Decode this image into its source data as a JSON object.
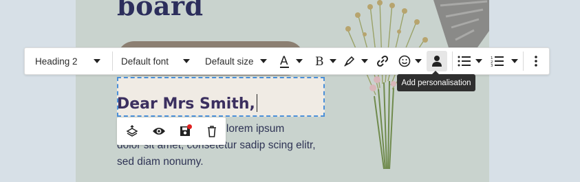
{
  "canvas": {
    "title": "board",
    "greeting": "Dear Mrs Smith,",
    "body_lines": [
      "p lorem ipsum",
      "dolor sit amet, consetetur sadip scing elitr,",
      "sed diam nonumy."
    ]
  },
  "toolbar": {
    "block_style": "Heading 2",
    "font": "Default font",
    "size": "Default size",
    "icons": [
      "font-color-icon",
      "bold-icon",
      "highlighter-icon",
      "link-icon",
      "emoji-icon",
      "person-icon",
      "bulleted-list-icon",
      "numbered-list-icon",
      "more-options-icon"
    ]
  },
  "tooltip": {
    "text": "Add personalisation"
  },
  "block_toolbar": {
    "icons": [
      "layers-icon",
      "eye-icon",
      "save-icon",
      "trash-icon"
    ],
    "save_has_changes": true
  },
  "colors": {
    "heading": "#2c2e5c",
    "greeting": "#3b2f5f",
    "selection_border": "#4a8fd9",
    "unsaved_dot": "#e02020"
  }
}
